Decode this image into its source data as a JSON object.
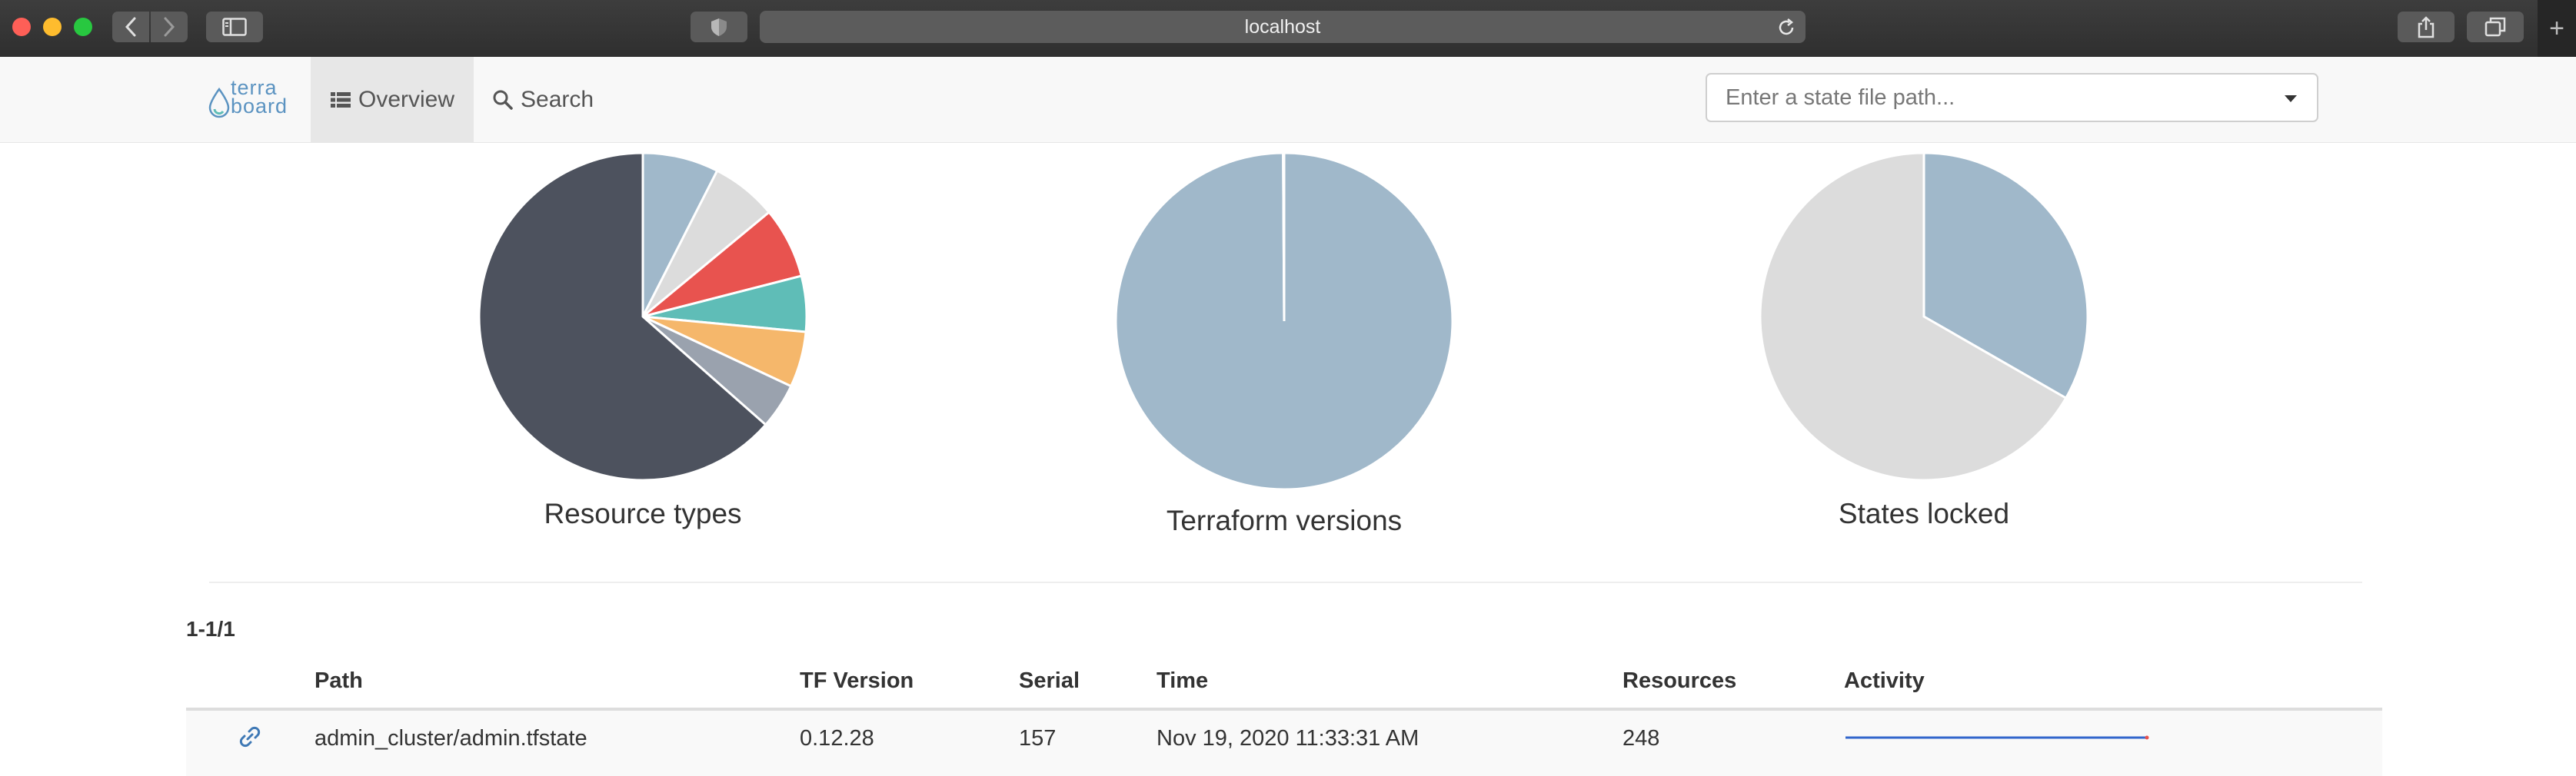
{
  "browser": {
    "address": "localhost",
    "icons": [
      "back-icon",
      "forward-icon",
      "sidebar-icon",
      "shield-icon",
      "reload-icon",
      "share-icon",
      "tabs-icon",
      "plus-icon"
    ]
  },
  "navbar": {
    "logo_line1": "terra",
    "logo_line2": "board",
    "overview_label": "Overview",
    "search_label": "Search",
    "state_placeholder": "Enter a state file path...",
    "colors": {
      "logo": "#5b93c1",
      "active_bg": "#e7e7e7"
    }
  },
  "chart_data": [
    {
      "type": "pie",
      "title": "Resource types",
      "slices": [
        {
          "value": 7.5,
          "color": "#a0b8ca"
        },
        {
          "value": 6.5,
          "color": "#dcdcdc"
        },
        {
          "value": 7,
          "color": "#e8534f"
        },
        {
          "value": 5.5,
          "color": "#5fbdb7"
        },
        {
          "value": 5.5,
          "color": "#f5b76b"
        },
        {
          "value": 4.5,
          "color": "#9aa2ae"
        },
        {
          "value": 63.5,
          "color": "#4d525e"
        }
      ]
    },
    {
      "type": "pie",
      "title": "Terraform versions",
      "slices": [
        {
          "value": 99.9,
          "color": "#a0b8ca"
        },
        {
          "value": 0.1,
          "color": "#a0b8ca"
        }
      ]
    },
    {
      "type": "pie",
      "title": "States locked",
      "slices": [
        {
          "value": 33.3,
          "color": "#a0b8ca"
        },
        {
          "value": 66.7,
          "color": "#dcdcdc"
        }
      ]
    }
  ],
  "table": {
    "count": "1-1/1",
    "headers": {
      "path": "Path",
      "tf_version": "TF Version",
      "serial": "Serial",
      "time": "Time",
      "resources": "Resources",
      "activity": "Activity"
    },
    "rows": [
      {
        "path": "admin_cluster/admin.tfstate",
        "tf_version": "0.12.28",
        "serial": "157",
        "time": "Nov 19, 2020 11:33:31 AM",
        "resources": "248",
        "activity_colors": [
          "#3366cc",
          "#e8534f"
        ]
      }
    ]
  }
}
